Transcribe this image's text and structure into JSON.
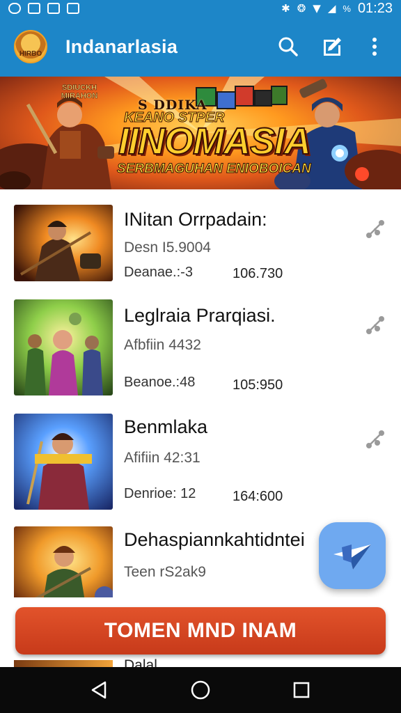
{
  "status_bar": {
    "battery": "%",
    "time": "01:23"
  },
  "app_bar": {
    "logo_text": "HIRBO",
    "title": "Indanarlasia"
  },
  "banner": {
    "corner_text": "SDIUCKH MIRAHON",
    "top_line": "S DDIKA",
    "sub_line": "KEANO STPER",
    "main_title": "IINOMASIA",
    "bottom_line": "SERBMAGUHAN ENIOBOICAN"
  },
  "list": {
    "items": [
      {
        "title": "INitan Orrpadain:",
        "subtitle": "Desn I5.9004",
        "meta": "Deanae.:-3",
        "value": "106.730",
        "thumb_palette": "fire"
      },
      {
        "title": "Leglraia Prarqiasi.",
        "subtitle": "Afbfiin 4432",
        "meta": "Beanoe.:48",
        "value": "105:950",
        "thumb_palette": "team"
      },
      {
        "title": "Benmlaka",
        "subtitle": "Afifiin 42:31",
        "meta": "Denrioe: 12",
        "value": "164:600",
        "thumb_palette": "blue"
      },
      {
        "title": "Dehaspiannkahtidntei",
        "subtitle": "Teen rS2ak9",
        "meta": "",
        "value": "",
        "thumb_palette": "orange"
      }
    ],
    "peek_title": "Dalal"
  },
  "cta": {
    "label": "TOMEN MND INAM"
  },
  "colors": {
    "app_bar": "#1d86c8",
    "cta": "#d9482a",
    "fab": "#6fa9f0"
  }
}
